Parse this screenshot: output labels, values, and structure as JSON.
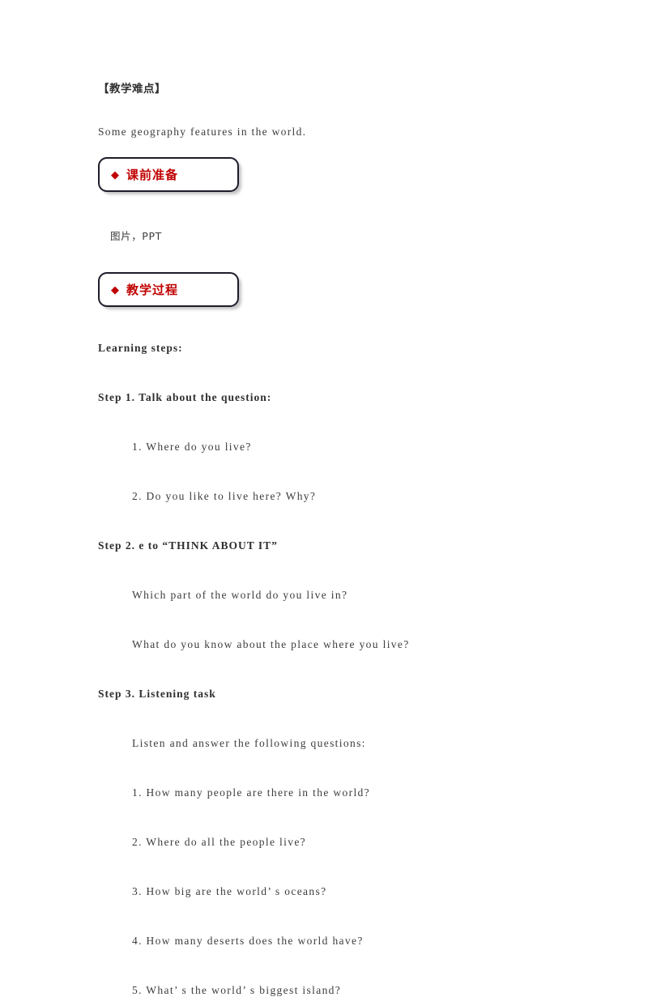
{
  "document": {
    "heading_difficulty": "【教学难点】",
    "difficulty_text": "Some geography features in the world.",
    "sections": [
      {
        "id": "preparation",
        "diamond": "◆",
        "label": "课前准备",
        "accent_color": "#C00000",
        "border_color": "#1D1D2B"
      },
      {
        "id": "process",
        "diamond": "◆",
        "label": "教学过程",
        "accent_color": "#C00000",
        "border_color": "#1D1D2B"
      }
    ],
    "preparation_note": "图片，PPT",
    "learning_steps_title": "Learning steps:",
    "steps": [
      {
        "id": "step-1",
        "heading": "Step 1. Talk about the question:",
        "items": [
          "1. Where do you live?",
          "2. Do you like to live here? Why?"
        ]
      },
      {
        "id": "step-2",
        "heading": "Step 2. e to “THINK ABOUT IT”",
        "items": [
          "Which part of the world do you live in?",
          "What do you know about the place where you live?"
        ]
      },
      {
        "id": "step-3",
        "heading": "Step 3. Listening task",
        "items": [
          "Listen and answer the following questions:",
          "1. How many people are there in the world?",
          "2. Where do all the people live?",
          "3. How big are the world’ s oceans?",
          "4. How many deserts does the world have?",
          "5. What’ s the world’ s biggest island?"
        ]
      }
    ]
  }
}
